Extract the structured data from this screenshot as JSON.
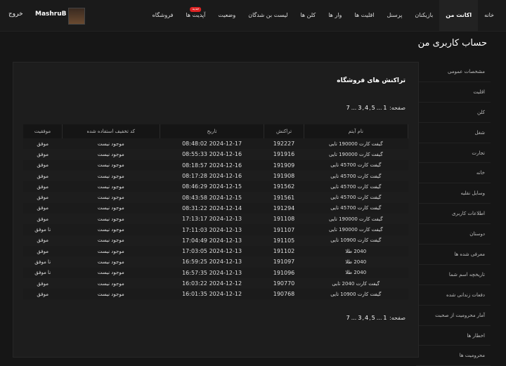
{
  "header": {
    "logout": "خروج",
    "username": "MashruB",
    "nav": [
      {
        "label": "خانه",
        "active": false
      },
      {
        "label": "اکانت من",
        "active": true
      },
      {
        "label": "بازیکنان",
        "active": false
      },
      {
        "label": "پرسنل",
        "active": false
      },
      {
        "label": "اقلیت ها",
        "active": false
      },
      {
        "label": "وار ها",
        "active": false
      },
      {
        "label": "کلن ها",
        "active": false
      },
      {
        "label": "لیست بن شدگان",
        "active": false
      },
      {
        "label": "وضعیت",
        "active": false
      },
      {
        "label": "آپدیت ها",
        "active": false,
        "badge": "جدید"
      },
      {
        "label": "فروشگاه",
        "active": false
      }
    ]
  },
  "page_title": "حساب کاربری من",
  "sidebar": [
    "مشخصات عمومی",
    "اقلیت",
    "کلن",
    "شغل",
    "تجارت",
    "خانه",
    "وسایل نقلیه",
    "اطلاعات کاربری",
    "دوستان",
    "معرفی شده ها",
    "تاریخچه اسم شما",
    "دفعات زندانی شده",
    "آمار محرومیت از صحبت",
    "اخطار ها",
    "محرومیت ها"
  ],
  "panel": {
    "title": "تراکنش های فروشگاه",
    "pager_label": "صفحه:",
    "pages": [
      "1",
      "...",
      "3",
      "4",
      "5",
      "...",
      "7"
    ],
    "columns": [
      "نام آیتم",
      "تراکنش",
      "تاریخ",
      "کد تخفیف استفاده شده",
      "موفقیت"
    ],
    "rows": [
      {
        "item": "گیفت کارت 190000 تایی",
        "tx": "192227",
        "date": "2024-12-17 08:48:02",
        "code": "موجود نیست",
        "status": "موفق",
        "ok": true
      },
      {
        "item": "گیفت کارت 190000 تایی",
        "tx": "191916",
        "date": "2024-12-16 08:55:33",
        "code": "موجود نیست",
        "status": "موفق",
        "ok": true
      },
      {
        "item": "گیفت کارت 45700 تایی",
        "tx": "191909",
        "date": "2024-12-16 08:18:57",
        "code": "موجود نیست",
        "status": "موفق",
        "ok": true
      },
      {
        "item": "گیفت کارت 45700 تایی",
        "tx": "191908",
        "date": "2024-12-16 08:17:28",
        "code": "موجود نیست",
        "status": "موفق",
        "ok": true
      },
      {
        "item": "گیفت کارت 45700 تایی",
        "tx": "191562",
        "date": "2024-12-15 08:46:29",
        "code": "موجود نیست",
        "status": "موفق",
        "ok": true
      },
      {
        "item": "گیفت کارت 45700 تایی",
        "tx": "191561",
        "date": "2024-12-15 08:43:58",
        "code": "موجود نیست",
        "status": "موفق",
        "ok": true
      },
      {
        "item": "گیفت کارت 45700 تایی",
        "tx": "191294",
        "date": "2024-12-14 08:31:22",
        "code": "موجود نیست",
        "status": "موفق",
        "ok": true
      },
      {
        "item": "گیفت کارت 190000 تایی",
        "tx": "191108",
        "date": "2024-12-13 17:13:17",
        "code": "موجود نیست",
        "status": "موفق",
        "ok": true
      },
      {
        "item": "گیفت کارت 190000 تایی",
        "tx": "191107",
        "date": "2024-12-13 17:11:03",
        "code": "موجود نیست",
        "status": "نا موفق",
        "ok": false
      },
      {
        "item": "گیفت کارت 10900 تایی",
        "tx": "191105",
        "date": "2024-12-13 17:04:49",
        "code": "موجود نیست",
        "status": "موفق",
        "ok": true
      },
      {
        "item": "2040 طلا",
        "tx": "191102",
        "date": "2024-12-13 17:03:05",
        "code": "موجود نیست",
        "status": "موفق",
        "ok": true
      },
      {
        "item": "2040 طلا",
        "tx": "191097",
        "date": "2024-12-13 16:59:25",
        "code": "موجود نیست",
        "status": "نا موفق",
        "ok": false
      },
      {
        "item": "2040 طلا",
        "tx": "191096",
        "date": "2024-12-13 16:57:35",
        "code": "موجود نیست",
        "status": "نا موفق",
        "ok": false
      },
      {
        "item": "گیفت کارت 2040 تایی",
        "tx": "190770",
        "date": "2024-12-12 16:03:22",
        "code": "موجود نیست",
        "status": "موفق",
        "ok": true
      },
      {
        "item": "گیفت کارت 10900 تایی",
        "tx": "190768",
        "date": "2024-12-12 16:01:35",
        "code": "موجود نیست",
        "status": "موفق",
        "ok": true
      }
    ]
  }
}
